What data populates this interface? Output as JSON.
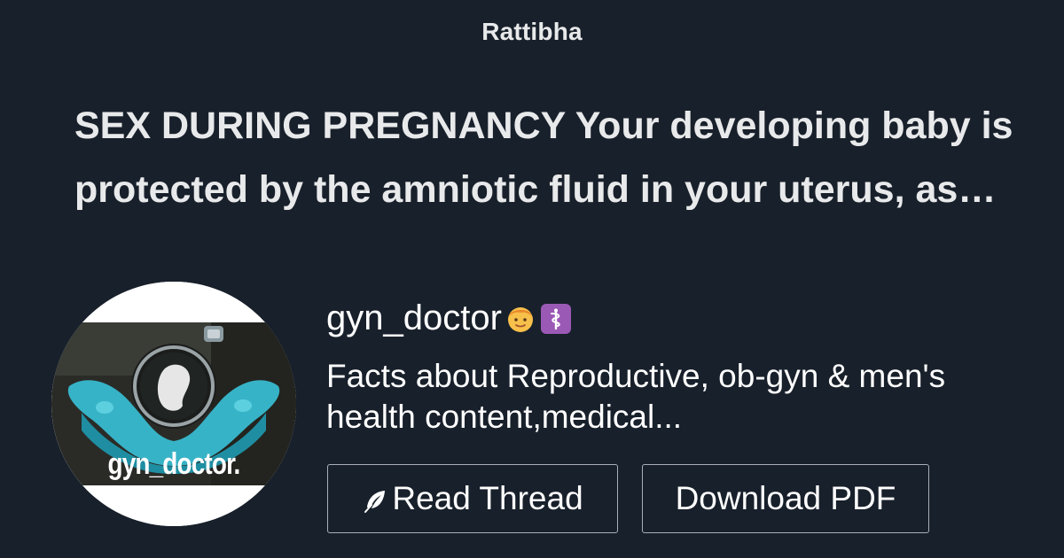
{
  "brand": "Rattibha",
  "headline": "SEX DURING PREGNANCY Your developing baby is protected by the amniotic fluid in your uterus, as well as the strong muscles of the uterus itself.",
  "author": {
    "username": "gyn_doctor",
    "emoji": [
      "boy-face-icon",
      "medical-symbol-icon"
    ],
    "bio": "Facts about Reproductive, ob-gyn & men's health content,medical...",
    "avatar_caption": "gyn_doctor."
  },
  "buttons": {
    "read_thread": "Read Thread",
    "read_thread_icon": "feather-icon",
    "download_pdf": "Download PDF"
  },
  "colors": {
    "background": "#18202b",
    "text": "#ffffff",
    "button_border": "#aab0b8",
    "avatar_accent": "#2fb3c9"
  }
}
